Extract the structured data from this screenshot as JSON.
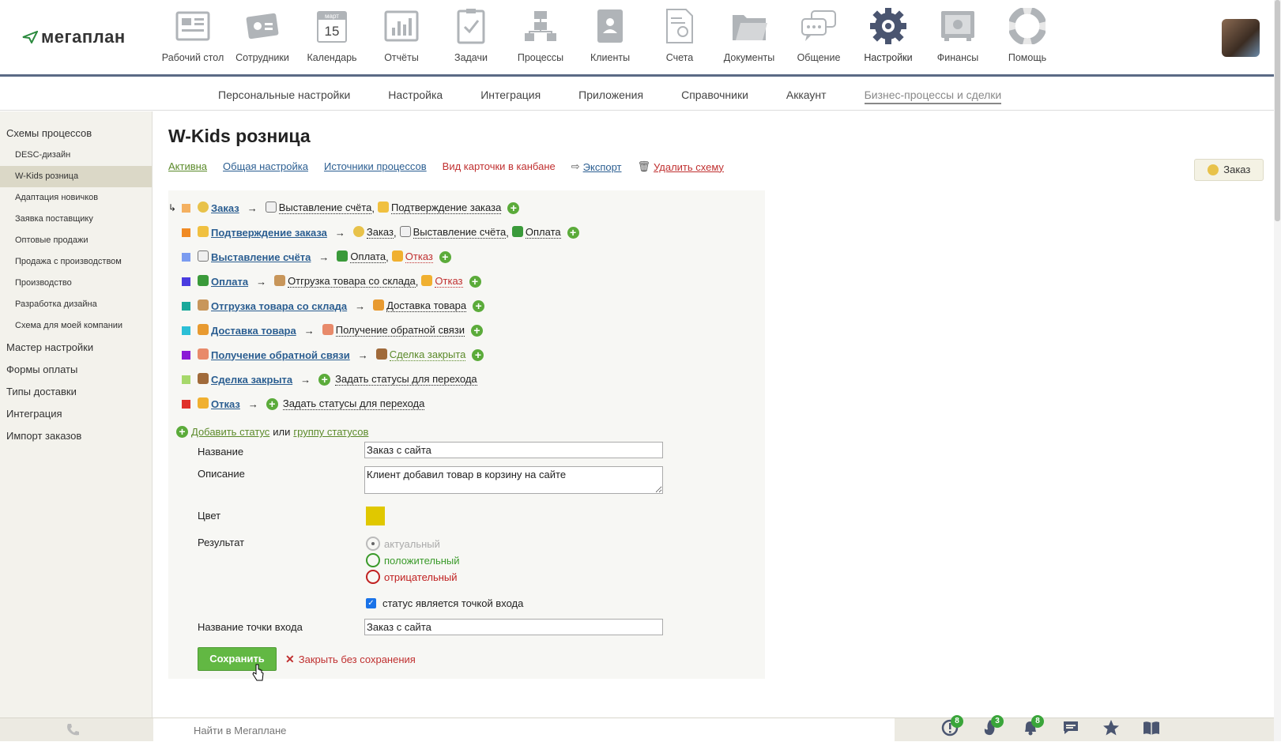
{
  "app": {
    "logo_text": "мегаплан",
    "brand_color": "#2b8a3e"
  },
  "nav": [
    {
      "label": "Рабочий стол",
      "icon": "desktop-icon"
    },
    {
      "label": "Сотрудники",
      "icon": "employees-icon"
    },
    {
      "label": "Календарь",
      "icon": "calendar-icon",
      "calendar_month": "март",
      "calendar_day": "15"
    },
    {
      "label": "Отчёты",
      "icon": "reports-icon"
    },
    {
      "label": "Задачи",
      "icon": "tasks-icon"
    },
    {
      "label": "Процессы",
      "icon": "processes-icon"
    },
    {
      "label": "Клиенты",
      "icon": "clients-icon"
    },
    {
      "label": "Счета",
      "icon": "invoices-icon"
    },
    {
      "label": "Документы",
      "icon": "documents-icon"
    },
    {
      "label": "Общение",
      "icon": "chat-icon"
    },
    {
      "label": "Настройки",
      "icon": "gear-icon",
      "active": true
    },
    {
      "label": "Финансы",
      "icon": "safe-icon"
    },
    {
      "label": "Помощь",
      "icon": "lifebuoy-icon"
    }
  ],
  "subnav": [
    "Персональные настройки",
    "Настройка",
    "Интеграция",
    "Приложения",
    "Справочники",
    "Аккаунт",
    "Бизнес-процессы и сделки"
  ],
  "sidebar": {
    "items": [
      {
        "label": "Схемы процессов",
        "sub": false
      },
      {
        "label": "DESC-дизайн",
        "sub": true
      },
      {
        "label": "W-Kids розница",
        "sub": true,
        "active": true
      },
      {
        "label": "Адаптация новичков",
        "sub": true
      },
      {
        "label": "Заявка поставщику",
        "sub": true
      },
      {
        "label": "Оптовые продажи",
        "sub": true
      },
      {
        "label": "Продажа с производством",
        "sub": true
      },
      {
        "label": "Производство",
        "sub": true
      },
      {
        "label": "Разработка дизайна",
        "sub": true
      },
      {
        "label": "Схема для моей компании",
        "sub": true
      },
      {
        "label": "Мастер настройки",
        "sub": false
      },
      {
        "label": "Формы оплаты",
        "sub": false
      },
      {
        "label": "Типы доставки",
        "sub": false
      },
      {
        "label": "Интеграция",
        "sub": false
      },
      {
        "label": "Импорт заказов",
        "sub": false
      }
    ]
  },
  "main": {
    "title": "W-Kids розница",
    "tabs": {
      "active": "Активна",
      "general": "Общая настройка",
      "sources": "Источники процессов",
      "kanban": "Вид карточки в канбане",
      "export": "Экспорт",
      "delete": "Удалить схему"
    },
    "order_badge": "Заказ",
    "statuses": [
      {
        "name": "Заказ",
        "color": "#f4b060",
        "icon": "moneybag-icon",
        "targets": [
          {
            "label": "Выставление счёта",
            "icon": "invoice-icon",
            "tone": "normal"
          },
          {
            "label": "Подтверждение заказа",
            "icon": "thumbsup-icon",
            "tone": "normal"
          }
        ]
      },
      {
        "name": "Подтверждение заказа",
        "color": "#f08a24",
        "icon": "thumbsup-icon",
        "targets": [
          {
            "label": "Заказ",
            "icon": "moneybag-icon",
            "tone": "normal"
          },
          {
            "label": "Выставление счёта",
            "icon": "invoice-icon",
            "tone": "normal"
          },
          {
            "label": "Оплата",
            "icon": "dollar-icon",
            "tone": "normal"
          }
        ]
      },
      {
        "name": "Выставление счёта",
        "color": "#7b9cf0",
        "icon": "invoice-icon",
        "targets": [
          {
            "label": "Оплата",
            "icon": "dollar-icon",
            "tone": "normal"
          },
          {
            "label": "Отказ",
            "icon": "thumbsdown-icon",
            "tone": "red"
          }
        ]
      },
      {
        "name": "Оплата",
        "color": "#4a3ce0",
        "icon": "dollar-icon",
        "targets": [
          {
            "label": "Отгрузка товара со склада",
            "icon": "box-icon",
            "tone": "normal"
          },
          {
            "label": "Отказ",
            "icon": "thumbsdown-icon",
            "tone": "red"
          }
        ]
      },
      {
        "name": "Отгрузка товара со склада",
        "color": "#1aa89a",
        "icon": "box-icon",
        "targets": [
          {
            "label": "Доставка товара",
            "icon": "gift-icon",
            "tone": "normal"
          }
        ]
      },
      {
        "name": "Доставка товара",
        "color": "#2bbfd6",
        "icon": "gift-icon",
        "targets": [
          {
            "label": "Получение обратной связи",
            "icon": "person-icon",
            "tone": "normal"
          }
        ]
      },
      {
        "name": "Получение обратной связи",
        "color": "#8a1ad6",
        "icon": "person-icon",
        "targets": [
          {
            "label": "Сделка закрыта",
            "icon": "gavel-icon",
            "tone": "green"
          }
        ]
      },
      {
        "name": "Сделка закрыта",
        "color": "#a6d86a",
        "icon": "gavel-icon",
        "targets": [],
        "set_label": "Задать статусы для перехода"
      },
      {
        "name": "Отказ",
        "color": "#e0302a",
        "icon": "thumbsdown-icon",
        "targets": [],
        "set_label": "Задать статусы для перехода"
      }
    ],
    "add": {
      "add_status": "Добавить статус",
      "or": "или",
      "group": "группу статусов"
    },
    "form": {
      "name_label": "Название",
      "name_value": "Заказ с сайта",
      "desc_label": "Описание",
      "desc_value": "Клиент добавил товар в корзину на сайте",
      "color_label": "Цвет",
      "color_value": "#e0c800",
      "result_label": "Результат",
      "result_options": [
        "актуальный",
        "положительный",
        "отрицательный"
      ],
      "entry_checkbox": "статус является точкой входа",
      "entry_name_label": "Название точки входа",
      "entry_name_value": "Заказ с сайта",
      "save": "Сохранить",
      "cancel": "Закрыть без сохранения"
    }
  },
  "bottombar": {
    "search_placeholder": "Найти в Мегаплане",
    "icons": [
      {
        "icon": "alert-icon",
        "badge": "8"
      },
      {
        "icon": "fire-icon",
        "badge": "3"
      },
      {
        "icon": "bell-icon",
        "badge": "8"
      },
      {
        "icon": "message-icon",
        "badge": ""
      },
      {
        "icon": "star-icon",
        "badge": ""
      },
      {
        "icon": "book-icon",
        "badge": ""
      }
    ]
  }
}
